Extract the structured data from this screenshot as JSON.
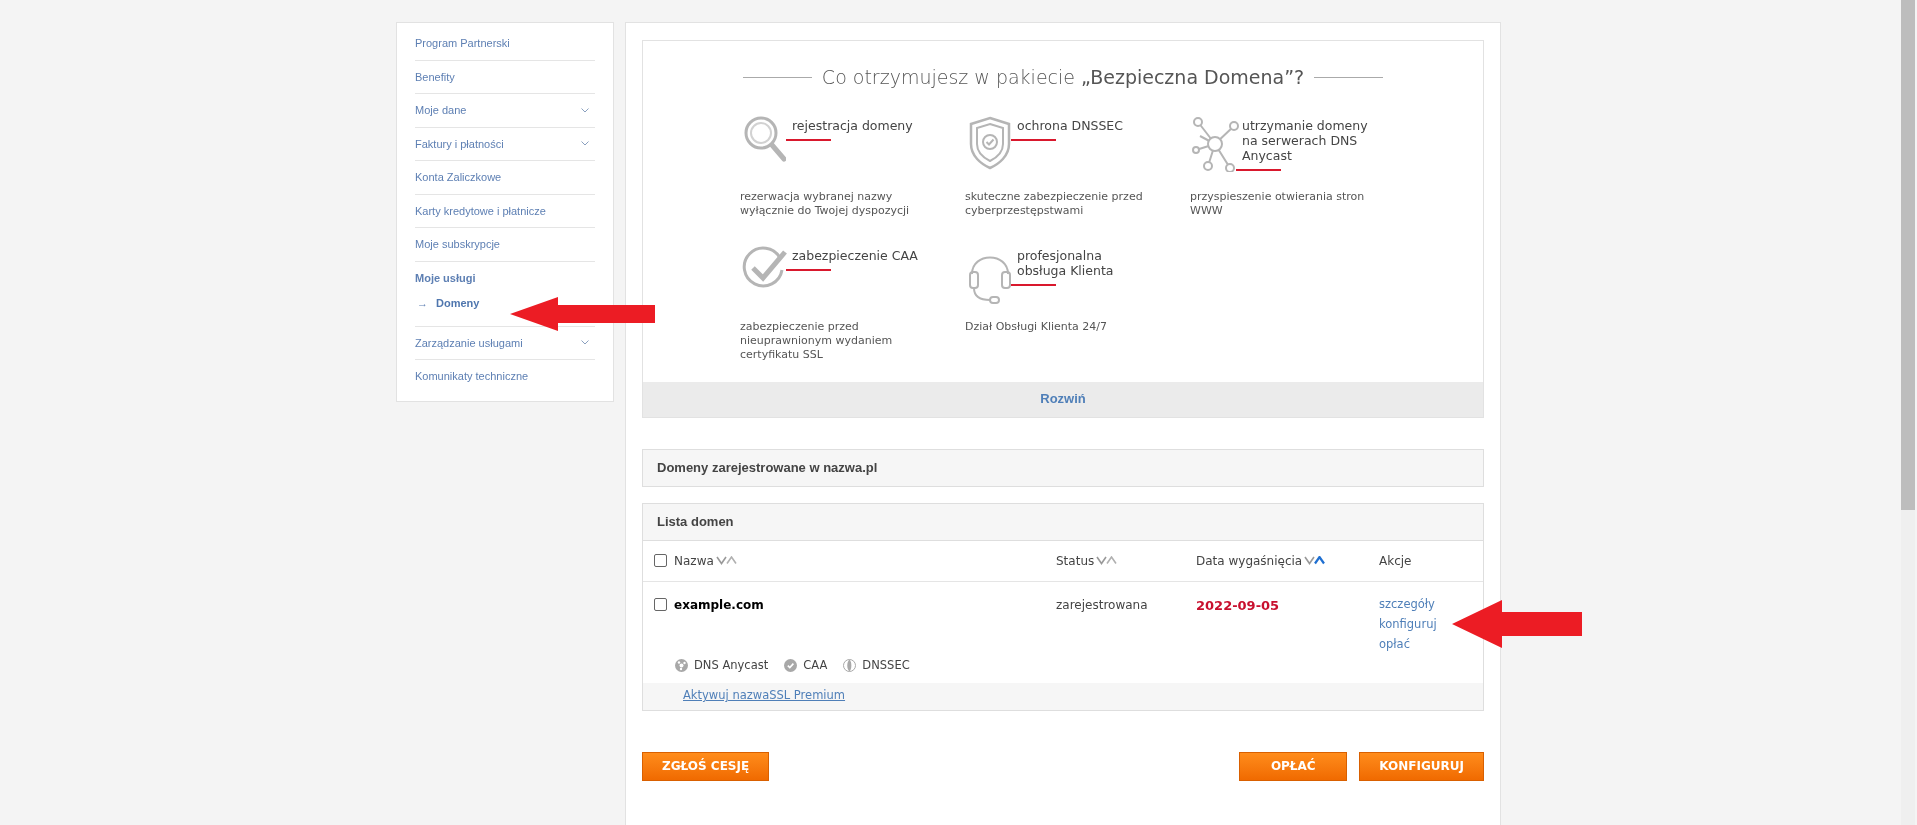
{
  "sidebar": {
    "items": [
      {
        "label": "Program Partnerski",
        "kind": "link",
        "selected": false
      },
      {
        "label": "Benefity",
        "kind": "link",
        "selected": false
      },
      {
        "label": "Moje dane",
        "kind": "expandable",
        "selected": false
      },
      {
        "label": "Faktury i płatności",
        "kind": "expandable",
        "selected": false
      },
      {
        "label": "Konta Zaliczkowe",
        "kind": "link",
        "selected": false
      },
      {
        "label": "Karty kredytowe i płatnicze",
        "kind": "link",
        "selected": false
      },
      {
        "label": "Moje subskrypcje",
        "kind": "link",
        "selected": false
      },
      {
        "label": "Moje usługi",
        "kind": "heading",
        "selected": false,
        "children": [
          {
            "label": "Domeny",
            "arrow": "→",
            "selected": true
          }
        ]
      },
      {
        "label": "Zarządzanie usługami",
        "kind": "expandable",
        "selected": false
      },
      {
        "label": "Komunikaty techniczne",
        "kind": "link",
        "selected": false
      }
    ]
  },
  "package": {
    "heading": "Co otrzymujesz w pakiecie **„Bezpieczna Domena”?**",
    "features": [
      {
        "title": "rejestracja domeny",
        "description": "rezerwacja wybranej nazwy wyłącznie do Twojej dyspozycji"
      },
      {
        "title": "ochrona DNSSEC",
        "description": "skuteczne zabezpieczenie przed cyberprzestępstwami"
      },
      {
        "title": "utrzymanie domeny na serwerach DNS Anycast",
        "description": "przyspieszenie otwierania stron WWW"
      },
      {
        "title": "zabezpieczenie CAA",
        "description": "zabezpieczenie przed nieuprawnionym wydaniem certyfikatu SSL"
      },
      {
        "title": "profesjonalna obsługa Klienta",
        "description": "Dział Obsługi Klienta 24/7"
      }
    ],
    "expand_label": "Rozwiń"
  },
  "registered_title": "Domeny zarejestrowane w nazwa.pl",
  "domain_list": {
    "title": "Lista domen",
    "columns": [
      {
        "label": "Nazwa",
        "kind": "sortable",
        "sorted": false
      },
      {
        "label": "Status",
        "kind": "sortable",
        "sorted": false
      },
      {
        "label": "Data wygaśnięcia",
        "kind": "sortable",
        "sorted": true
      },
      {
        "label": "Akcje",
        "kind": "plain"
      }
    ],
    "header_checked": false,
    "rows": [
      {
        "checked": false,
        "name": "example.com",
        "status": "zarejestrowana",
        "expiry": "2022-09-05",
        "actions": [
          "szczegóły",
          "konfiguruj",
          "opłać"
        ],
        "services": [
          {
            "label": "DNS Anycast"
          },
          {
            "label": "CAA"
          },
          {
            "label": "DNSSEC"
          }
        ],
        "promo_link": "Aktywuj nazwaSSL Premium"
      }
    ]
  },
  "buttons_left": [
    "ZGŁOŚ CESJĘ"
  ],
  "buttons_right": [
    "OPŁAĆ",
    "KONFIGURUJ"
  ]
}
